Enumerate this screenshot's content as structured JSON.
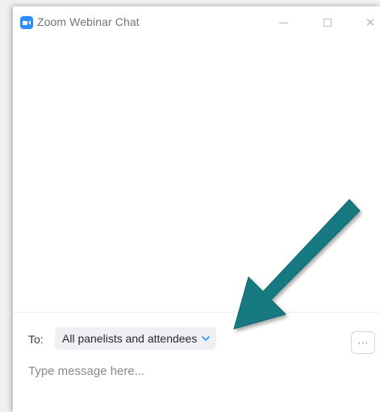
{
  "window": {
    "title": "Zoom Webinar Chat",
    "app_icon": "zoom-camera-icon",
    "controls": {
      "minimize_icon": "minimize-icon",
      "maximize_icon": "maximize-icon",
      "close_glyph": "✕"
    }
  },
  "compose": {
    "to_label": "To:",
    "recipient_value": "All panelists and attendees",
    "recipient_icon": "chevron-down-icon",
    "more_glyph": "···",
    "message_placeholder": "Type message here..."
  },
  "annotation": {
    "arrow_color": "#137a80",
    "arrow_icon": "pointer-arrow-icon"
  },
  "colors": {
    "zoom_blue": "#2d8cff",
    "recipient_bg": "#eef0f4",
    "chevron_blue": "#2d8cff"
  }
}
